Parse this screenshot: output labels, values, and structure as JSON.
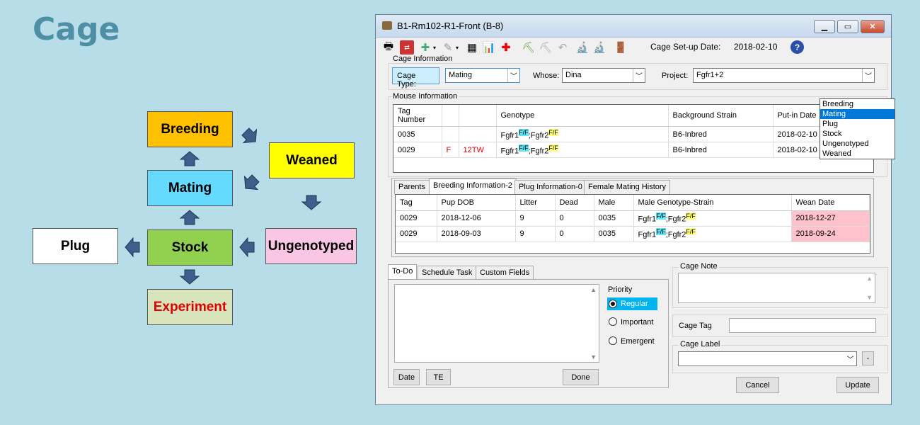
{
  "slide_title": "Cage",
  "flow": {
    "breeding": "Breeding",
    "weaned": "Weaned",
    "mating": "Mating",
    "plug": "Plug",
    "stock": "Stock",
    "ungenotyped": "Ungenotyped",
    "experiment": "Experiment",
    "colors": {
      "breeding": "#ffc000",
      "weaned": "#ffff00",
      "mating": "#66d9ff",
      "plug": "#ffffff",
      "stock": "#92d050",
      "ungenotyped": "#f9c6e3",
      "experiment": "#d8e4bc",
      "experiment_text": "#e00000",
      "arrow": "#3e5f8a"
    }
  },
  "window": {
    "title": "B1-Rm102-R1-Front  (B-8)",
    "minimize_icon": "minimize-icon",
    "restore_icon": "restore-icon",
    "close_icon": "close-icon"
  },
  "toolbar": {
    "setup_label": "Cage Set-up Date:",
    "setup_date": "2018-02-10",
    "help_icon": "?"
  },
  "cage_info": {
    "group_title": "Cage Information",
    "cage_type_label": "Cage Type:",
    "cage_type_value": "Mating",
    "cage_type_options": [
      "Breeding",
      "Mating",
      "Plug",
      "Stock",
      "Ungenotyped",
      "Weaned"
    ],
    "whose_label": "Whose:",
    "whose_value": "Dina",
    "project_label": "Project:",
    "project_value": "Fgfr1+2"
  },
  "mouse_info": {
    "group_title": "Mouse Information",
    "headers": [
      "Tag Number",
      "",
      "",
      "Genotype",
      "Background Strain",
      "Put-in Date"
    ],
    "rows": [
      {
        "tag": "0035",
        "sex": "",
        "id": "",
        "g1": "Fgfr1",
        "s1": "F/F",
        "g2": ";Fgfr2",
        "s2": "F/F",
        "strain": "B6-Inbred",
        "date": "2018-02-10"
      },
      {
        "tag": "0029",
        "sex": "F",
        "id": "12TW",
        "g1": "Fgfr1",
        "s1": "F/F",
        "g2": ";Fgfr2",
        "s2": "F/F",
        "strain": "B6-Inbred",
        "date": "2018-02-10"
      }
    ]
  },
  "breeding_tabs": {
    "tabs": [
      "Parents",
      "Breeding Information-2",
      "Plug Information-0",
      "Female Mating History"
    ],
    "headers": [
      "Tag",
      "Pup DOB",
      "Litter",
      "Dead",
      "Male",
      "Male Genotype-Strain",
      "Wean Date"
    ],
    "rows": [
      {
        "tag": "0029",
        "dob": "2018-12-06",
        "litter": "9",
        "dead": "0",
        "male": "0035",
        "g1": "Fgfr1",
        "s1": "F/F",
        "g2": ";Fgfr2",
        "s2": "F/F",
        "wean": "2018-12-27"
      },
      {
        "tag": "0029",
        "dob": "2018-09-03",
        "litter": "9",
        "dead": "0",
        "male": "0035",
        "g1": "Fgfr1",
        "s1": "F/F",
        "g2": ";Fgfr2",
        "s2": "F/F",
        "wean": "2018-09-24"
      }
    ]
  },
  "todo": {
    "tabs": [
      "To-Do",
      "Schedule Task",
      "Custom Fields"
    ],
    "priority_label": "Priority",
    "priorities": [
      "Regular",
      "Important",
      "Emergent"
    ],
    "date_btn": "Date",
    "te_btn": "TE",
    "done_btn": "Done"
  },
  "right_panel": {
    "cage_note": "Cage Note",
    "cage_tag": "Cage Tag",
    "cage_label": "Cage Label",
    "minus_btn": "-",
    "cancel_btn": "Cancel",
    "update_btn": "Update"
  }
}
